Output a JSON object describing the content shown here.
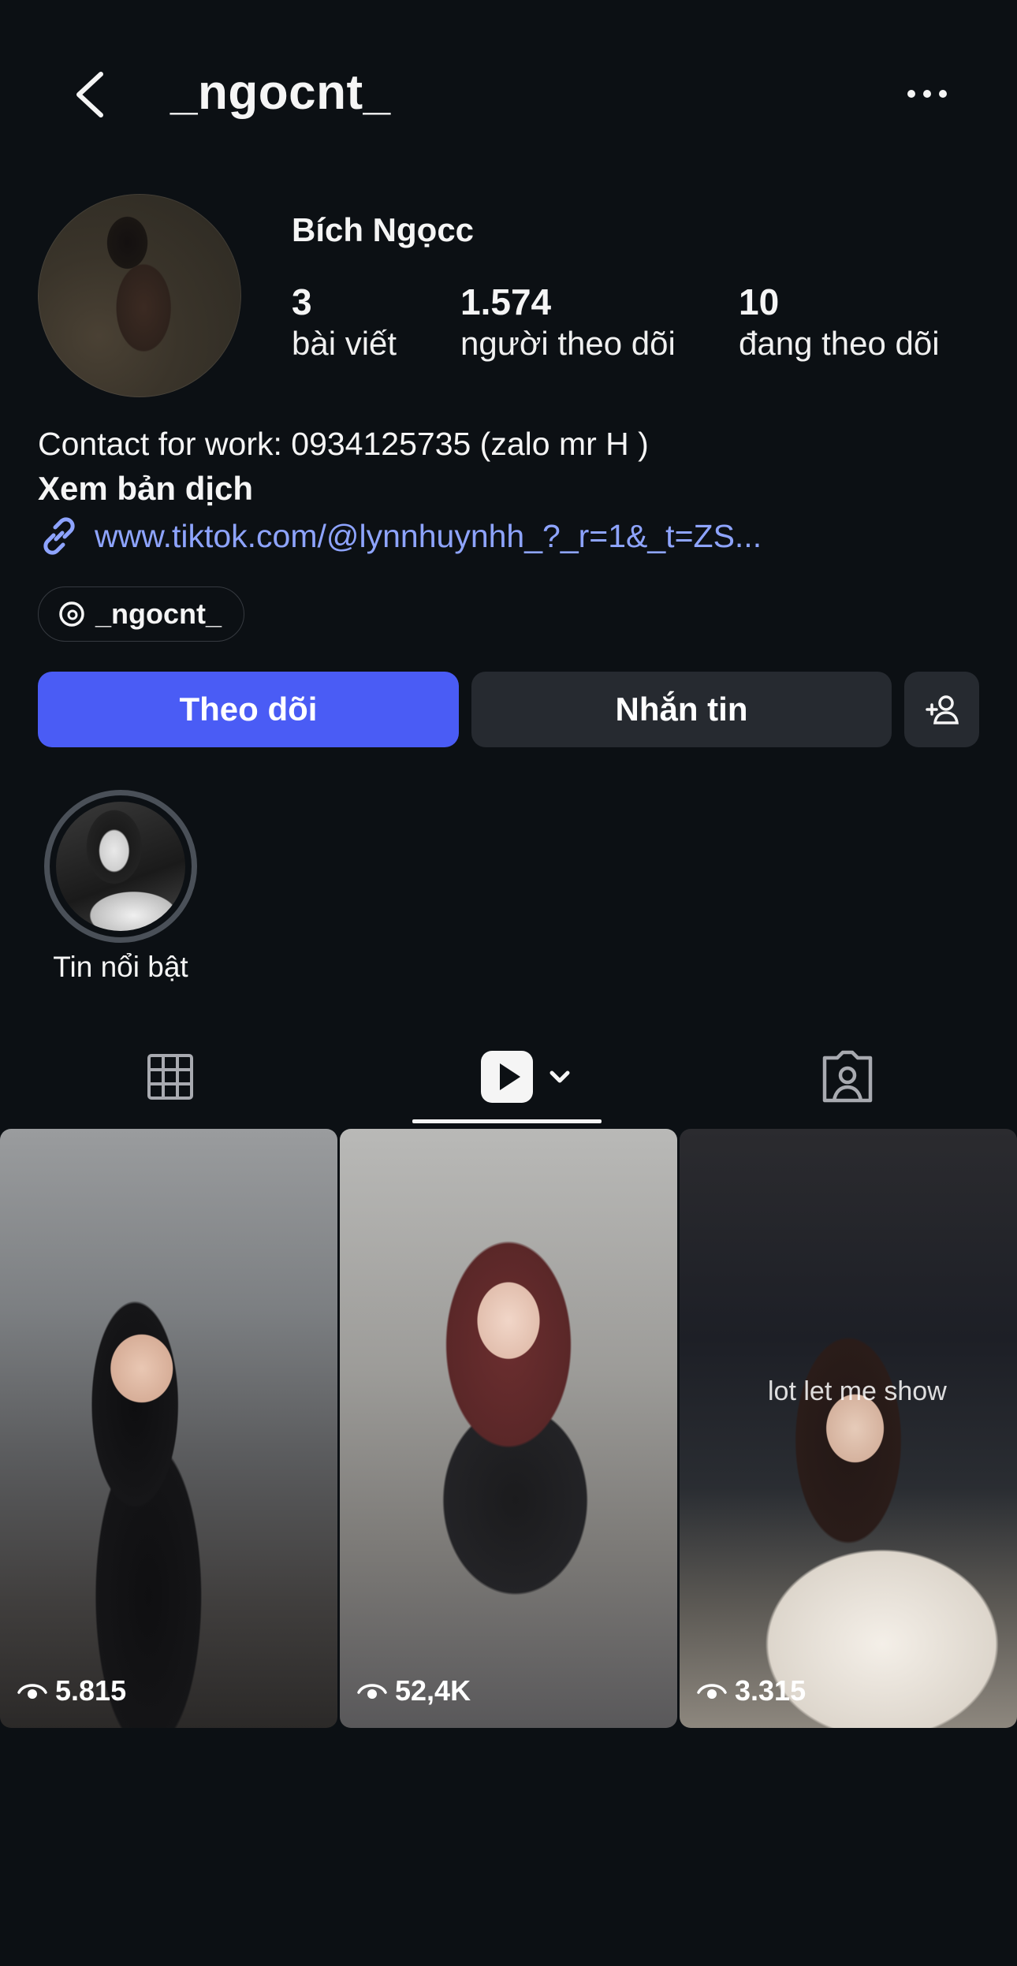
{
  "header": {
    "username": "_ngocnt_"
  },
  "profile": {
    "display_name": "Bích Ngọcc",
    "stats": [
      {
        "value": "3",
        "label": "bài viết"
      },
      {
        "value": "1.574",
        "label": "người theo dõi"
      },
      {
        "value": "10",
        "label": "đang theo dõi"
      }
    ],
    "bio": "Contact for work: 0934125735 (zalo mr H )",
    "translate_label": "Xem bản dịch",
    "link": "www.tiktok.com/@lynnhuynhh_?_r=1&_t=ZS...",
    "threads_handle": "_ngocnt_"
  },
  "actions": {
    "follow": "Theo dõi",
    "message": "Nhắn tin"
  },
  "highlights": [
    {
      "label": "Tin nổi bật"
    }
  ],
  "tabs": {
    "icons": [
      "grid-icon",
      "reels-icon",
      "tagged-icon"
    ],
    "active": "reels"
  },
  "reels": [
    {
      "views": "5.815",
      "caption": ""
    },
    {
      "views": "52,4K",
      "caption": ""
    },
    {
      "views": "3.315",
      "caption": "lot   let   me show"
    }
  ],
  "colors": {
    "background": "#0c1014",
    "accent": "#4a5cf5",
    "link": "#8ea4ff",
    "secondary_button": "#262a30"
  }
}
